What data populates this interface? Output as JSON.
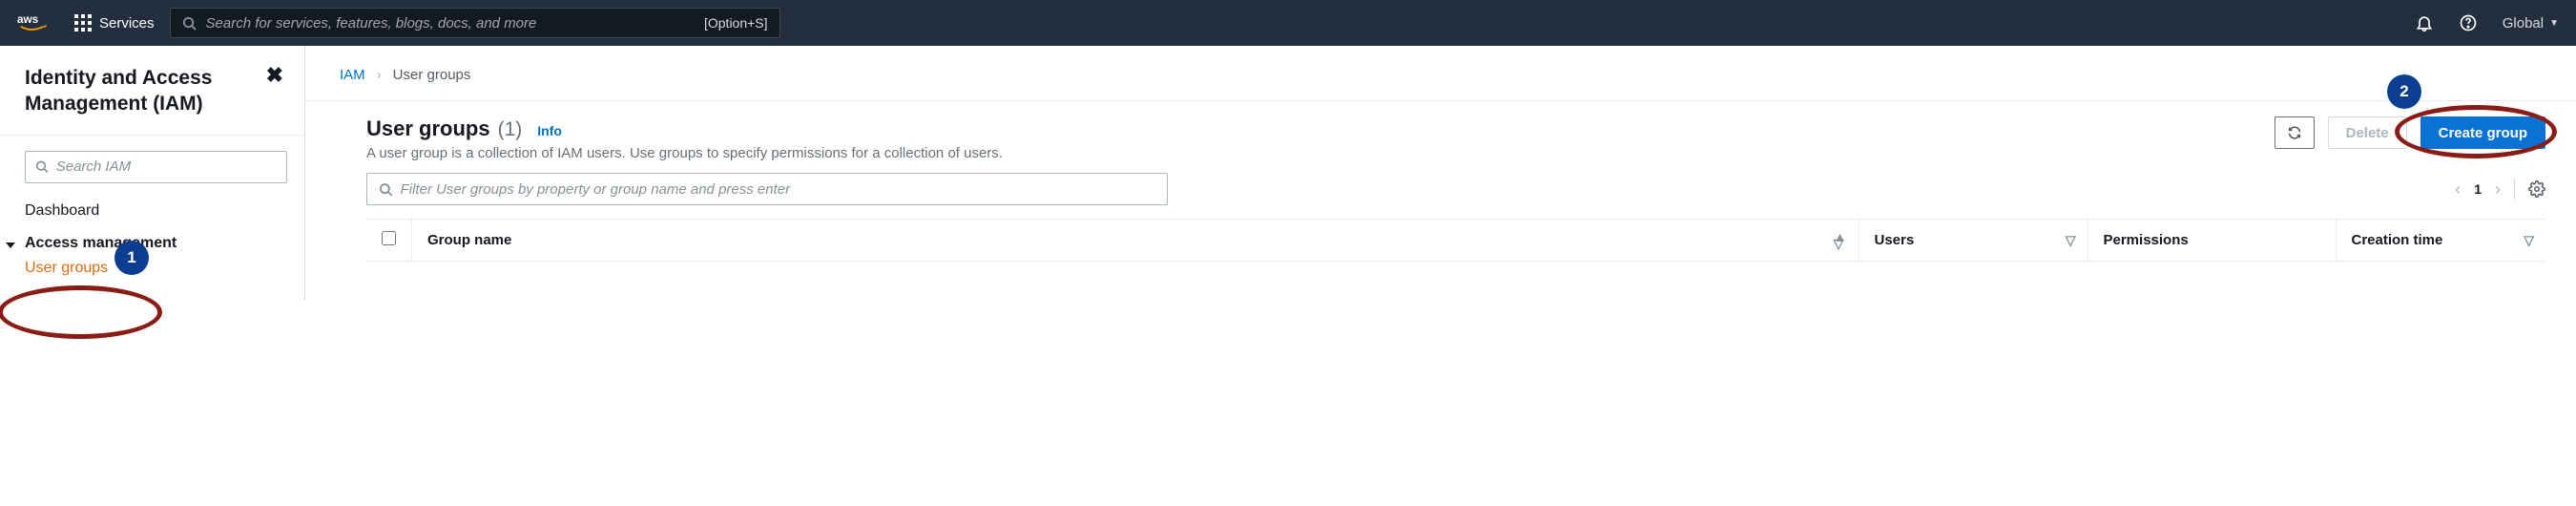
{
  "topbar": {
    "services_label": "Services",
    "search_placeholder": "Search for services, features, blogs, docs, and more",
    "shortcut": "[Option+S]",
    "region": "Global"
  },
  "sidebar": {
    "title": "Identity and Access Management (IAM)",
    "search_placeholder": "Search IAM",
    "dashboard": "Dashboard",
    "section_access": "Access management",
    "user_groups": "User groups"
  },
  "annotations": {
    "badge1": "1",
    "badge2": "2"
  },
  "breadcrumb": {
    "root": "IAM",
    "current": "User groups"
  },
  "panel": {
    "title": "User groups",
    "count": "(1)",
    "info": "Info",
    "desc": "A user group is a collection of IAM users. Use groups to specify permissions for a collection of users.",
    "delete": "Delete",
    "create": "Create group",
    "filter_placeholder": "Filter User groups by property or group name and press enter",
    "page": "1"
  },
  "columns": {
    "group_name": "Group name",
    "users": "Users",
    "permissions": "Permissions",
    "creation": "Creation time"
  }
}
